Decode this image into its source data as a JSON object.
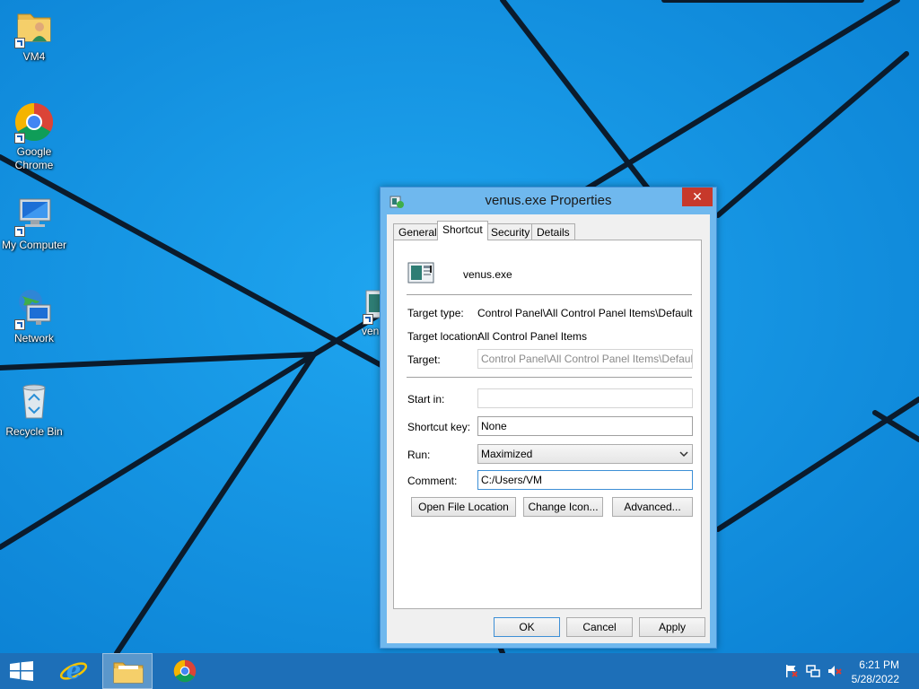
{
  "desktop": {
    "icons": [
      {
        "label": "VM4",
        "icon": "user-folder-icon"
      },
      {
        "label": "Google Chrome",
        "icon": "chrome-icon"
      },
      {
        "label": "My Computer",
        "icon": "computer-icon"
      },
      {
        "label": "Network",
        "icon": "network-icon"
      },
      {
        "label": "Recycle Bin",
        "icon": "recycle-bin-icon"
      }
    ],
    "partial_icon_label": "ven"
  },
  "dialog": {
    "title": "venus.exe Properties",
    "close_label": "✕",
    "tabs": [
      {
        "label": "General",
        "active": false
      },
      {
        "label": "Shortcut",
        "active": true
      },
      {
        "label": "Security",
        "active": false
      },
      {
        "label": "Details",
        "active": false
      }
    ],
    "file_name": "venus.exe",
    "target_type": {
      "label": "Target type:",
      "value": "Control Panel\\All Control Panel Items\\Default Progr"
    },
    "target_location": {
      "label": "Target location:",
      "value": "All Control Panel Items"
    },
    "target": {
      "label": "Target:",
      "value": "Control Panel\\All Control Panel Items\\Default Prog"
    },
    "start_in": {
      "label": "Start in:",
      "value": ""
    },
    "shortcut_key": {
      "label": "Shortcut key:",
      "value": "None"
    },
    "run": {
      "label": "Run:",
      "value": "Maximized"
    },
    "comment": {
      "label": "Comment:",
      "value": "C:/Users/VM"
    },
    "buttons": {
      "open_file_location": "Open File Location",
      "change_icon": "Change Icon...",
      "advanced": "Advanced...",
      "ok": "OK",
      "cancel": "Cancel",
      "apply": "Apply"
    }
  },
  "taskbar": {
    "clock_time": "6:21 PM",
    "clock_date": "5/28/2022"
  },
  "colors": {
    "wallpaper": "#0f8fe0",
    "taskbar": "#1d6fb8",
    "dialog_frame": "#6fb8ee",
    "close_button": "#c7392b"
  }
}
